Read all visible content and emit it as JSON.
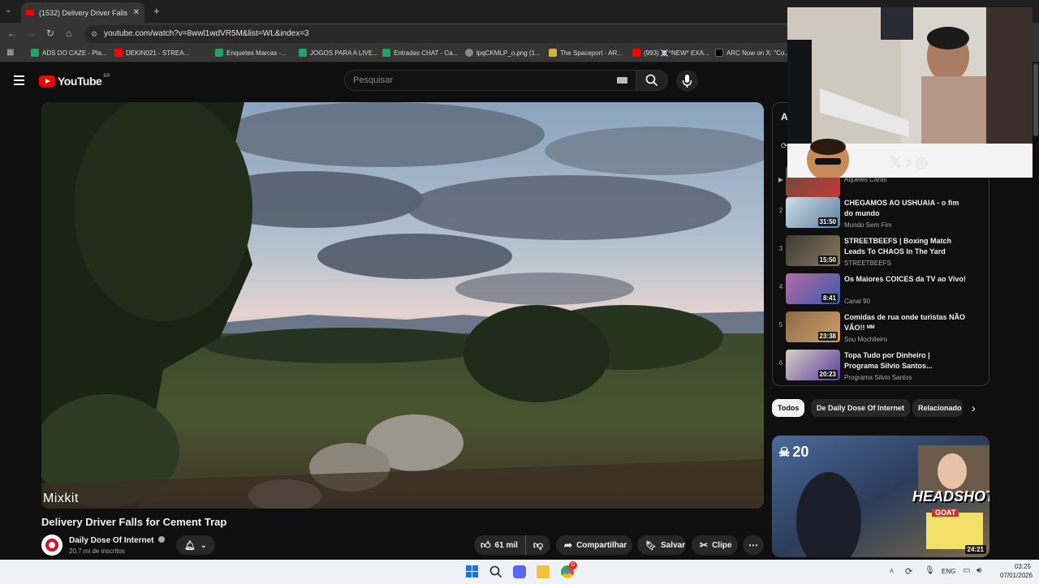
{
  "browser": {
    "tab_title": "(1532) Delivery Driver Falls for C",
    "url": "youtube.com/watch?v=8wwl1wdVR5M&list=WL&index=3",
    "bookmarks": [
      {
        "label": "ADS DO CAZE - Pla...",
        "icon": "sheets-icon"
      },
      {
        "label": "DEKIN021 - STREA...",
        "icon": "youtube-icon"
      },
      {
        "label": "Enquetes Marcas -...",
        "icon": "sheets-icon"
      },
      {
        "label": "JOGOS PARA A LIVE...",
        "icon": "sheets-icon"
      },
      {
        "label": "Entradas CHAT - Ca...",
        "icon": "sheets-icon"
      },
      {
        "label": "lpqCKMLP_o.png (1...",
        "icon": "globe-icon"
      },
      {
        "label": "The Spaceport - AR...",
        "icon": "spaceport-icon"
      },
      {
        "label": "(993) ☠️*NEW* EXA...",
        "icon": "youtube-icon"
      },
      {
        "label": "ARC Now on X: \"Co...",
        "icon": "x-icon"
      }
    ]
  },
  "header": {
    "logo_text": "YouTube",
    "logo_region": "BR",
    "search_placeholder": "Pesquisar"
  },
  "video": {
    "watermark": "Mixkit",
    "title": "Delivery Driver Falls for Cement Trap",
    "channel": "Daily Dose Of Internet",
    "subscribers": "20,7 mi de inscritos",
    "likes": "61 mil",
    "share_label": "Compartilhar",
    "save_label": "Salvar",
    "clip_label": "Clipe"
  },
  "playlist": {
    "items": [
      {
        "index": "",
        "title": "",
        "channel": "Aqueles Caras",
        "duration": ""
      },
      {
        "index": "2",
        "title": "CHEGAMOS AO USHUAIA - o fim do mundo",
        "channel": "Mundo Sem Fim",
        "duration": "31:50"
      },
      {
        "index": "3",
        "title": "STREETBEEFS | Boxing Match Leads To CHAOS In The Yard",
        "channel": "STREETBEEFS",
        "duration": "15:50"
      },
      {
        "index": "4",
        "title": "Os Maiores COICES da TV ao Vivo!",
        "channel": "Canal 90",
        "duration": "8:41"
      },
      {
        "index": "5",
        "title": "Comidas de rua onde turistas NÃO VÃO!! ᴹᴹ",
        "channel": "Sou Mochileiro",
        "duration": "23:38"
      },
      {
        "index": "6",
        "title": "Topa Tudo por Dinheiro | Programa Silvio Santos...",
        "channel": "Programa Silvio Santos",
        "duration": "20:23"
      }
    ]
  },
  "chips": [
    "Todos",
    "De Daily Dose Of Internet",
    "Relacionado"
  ],
  "recommended": {
    "kill_count": "20",
    "overlay_text": "HEADSHOT",
    "badge": "GOAT",
    "duration": "24:21"
  },
  "taskbar": {
    "language": "ENG",
    "time": "03:25",
    "date": "07/01/2026",
    "chrome_badge": "0"
  }
}
